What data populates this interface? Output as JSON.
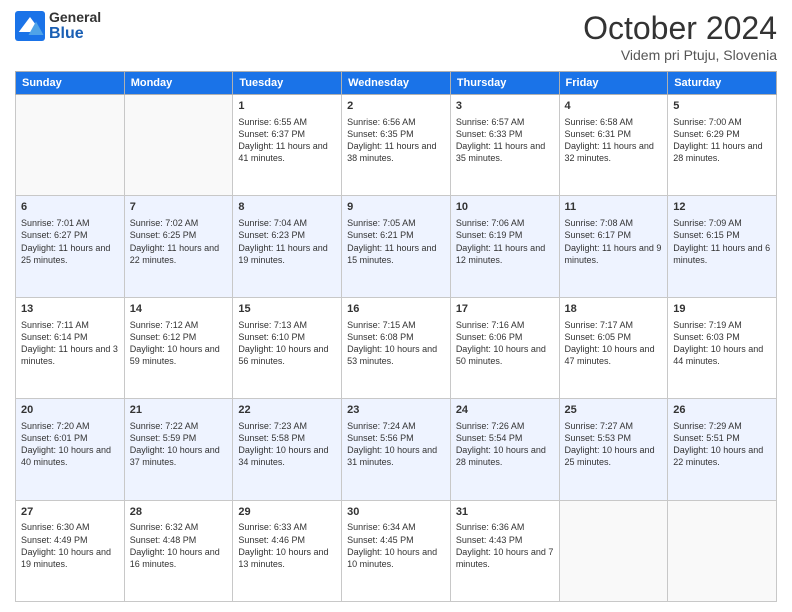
{
  "header": {
    "logo_general": "General",
    "logo_blue": "Blue",
    "month_title": "October 2024",
    "location": "Videm pri Ptuju, Slovenia"
  },
  "calendar": {
    "weekdays": [
      "Sunday",
      "Monday",
      "Tuesday",
      "Wednesday",
      "Thursday",
      "Friday",
      "Saturday"
    ],
    "weeks": [
      [
        {
          "day": "",
          "sunrise": "",
          "sunset": "",
          "daylight": ""
        },
        {
          "day": "",
          "sunrise": "",
          "sunset": "",
          "daylight": ""
        },
        {
          "day": "1",
          "sunrise": "Sunrise: 6:55 AM",
          "sunset": "Sunset: 6:37 PM",
          "daylight": "Daylight: 11 hours and 41 minutes."
        },
        {
          "day": "2",
          "sunrise": "Sunrise: 6:56 AM",
          "sunset": "Sunset: 6:35 PM",
          "daylight": "Daylight: 11 hours and 38 minutes."
        },
        {
          "day": "3",
          "sunrise": "Sunrise: 6:57 AM",
          "sunset": "Sunset: 6:33 PM",
          "daylight": "Daylight: 11 hours and 35 minutes."
        },
        {
          "day": "4",
          "sunrise": "Sunrise: 6:58 AM",
          "sunset": "Sunset: 6:31 PM",
          "daylight": "Daylight: 11 hours and 32 minutes."
        },
        {
          "day": "5",
          "sunrise": "Sunrise: 7:00 AM",
          "sunset": "Sunset: 6:29 PM",
          "daylight": "Daylight: 11 hours and 28 minutes."
        }
      ],
      [
        {
          "day": "6",
          "sunrise": "Sunrise: 7:01 AM",
          "sunset": "Sunset: 6:27 PM",
          "daylight": "Daylight: 11 hours and 25 minutes."
        },
        {
          "day": "7",
          "sunrise": "Sunrise: 7:02 AM",
          "sunset": "Sunset: 6:25 PM",
          "daylight": "Daylight: 11 hours and 22 minutes."
        },
        {
          "day": "8",
          "sunrise": "Sunrise: 7:04 AM",
          "sunset": "Sunset: 6:23 PM",
          "daylight": "Daylight: 11 hours and 19 minutes."
        },
        {
          "day": "9",
          "sunrise": "Sunrise: 7:05 AM",
          "sunset": "Sunset: 6:21 PM",
          "daylight": "Daylight: 11 hours and 15 minutes."
        },
        {
          "day": "10",
          "sunrise": "Sunrise: 7:06 AM",
          "sunset": "Sunset: 6:19 PM",
          "daylight": "Daylight: 11 hours and 12 minutes."
        },
        {
          "day": "11",
          "sunrise": "Sunrise: 7:08 AM",
          "sunset": "Sunset: 6:17 PM",
          "daylight": "Daylight: 11 hours and 9 minutes."
        },
        {
          "day": "12",
          "sunrise": "Sunrise: 7:09 AM",
          "sunset": "Sunset: 6:15 PM",
          "daylight": "Daylight: 11 hours and 6 minutes."
        }
      ],
      [
        {
          "day": "13",
          "sunrise": "Sunrise: 7:11 AM",
          "sunset": "Sunset: 6:14 PM",
          "daylight": "Daylight: 11 hours and 3 minutes."
        },
        {
          "day": "14",
          "sunrise": "Sunrise: 7:12 AM",
          "sunset": "Sunset: 6:12 PM",
          "daylight": "Daylight: 10 hours and 59 minutes."
        },
        {
          "day": "15",
          "sunrise": "Sunrise: 7:13 AM",
          "sunset": "Sunset: 6:10 PM",
          "daylight": "Daylight: 10 hours and 56 minutes."
        },
        {
          "day": "16",
          "sunrise": "Sunrise: 7:15 AM",
          "sunset": "Sunset: 6:08 PM",
          "daylight": "Daylight: 10 hours and 53 minutes."
        },
        {
          "day": "17",
          "sunrise": "Sunrise: 7:16 AM",
          "sunset": "Sunset: 6:06 PM",
          "daylight": "Daylight: 10 hours and 50 minutes."
        },
        {
          "day": "18",
          "sunrise": "Sunrise: 7:17 AM",
          "sunset": "Sunset: 6:05 PM",
          "daylight": "Daylight: 10 hours and 47 minutes."
        },
        {
          "day": "19",
          "sunrise": "Sunrise: 7:19 AM",
          "sunset": "Sunset: 6:03 PM",
          "daylight": "Daylight: 10 hours and 44 minutes."
        }
      ],
      [
        {
          "day": "20",
          "sunrise": "Sunrise: 7:20 AM",
          "sunset": "Sunset: 6:01 PM",
          "daylight": "Daylight: 10 hours and 40 minutes."
        },
        {
          "day": "21",
          "sunrise": "Sunrise: 7:22 AM",
          "sunset": "Sunset: 5:59 PM",
          "daylight": "Daylight: 10 hours and 37 minutes."
        },
        {
          "day": "22",
          "sunrise": "Sunrise: 7:23 AM",
          "sunset": "Sunset: 5:58 PM",
          "daylight": "Daylight: 10 hours and 34 minutes."
        },
        {
          "day": "23",
          "sunrise": "Sunrise: 7:24 AM",
          "sunset": "Sunset: 5:56 PM",
          "daylight": "Daylight: 10 hours and 31 minutes."
        },
        {
          "day": "24",
          "sunrise": "Sunrise: 7:26 AM",
          "sunset": "Sunset: 5:54 PM",
          "daylight": "Daylight: 10 hours and 28 minutes."
        },
        {
          "day": "25",
          "sunrise": "Sunrise: 7:27 AM",
          "sunset": "Sunset: 5:53 PM",
          "daylight": "Daylight: 10 hours and 25 minutes."
        },
        {
          "day": "26",
          "sunrise": "Sunrise: 7:29 AM",
          "sunset": "Sunset: 5:51 PM",
          "daylight": "Daylight: 10 hours and 22 minutes."
        }
      ],
      [
        {
          "day": "27",
          "sunrise": "Sunrise: 6:30 AM",
          "sunset": "Sunset: 4:49 PM",
          "daylight": "Daylight: 10 hours and 19 minutes."
        },
        {
          "day": "28",
          "sunrise": "Sunrise: 6:32 AM",
          "sunset": "Sunset: 4:48 PM",
          "daylight": "Daylight: 10 hours and 16 minutes."
        },
        {
          "day": "29",
          "sunrise": "Sunrise: 6:33 AM",
          "sunset": "Sunset: 4:46 PM",
          "daylight": "Daylight: 10 hours and 13 minutes."
        },
        {
          "day": "30",
          "sunrise": "Sunrise: 6:34 AM",
          "sunset": "Sunset: 4:45 PM",
          "daylight": "Daylight: 10 hours and 10 minutes."
        },
        {
          "day": "31",
          "sunrise": "Sunrise: 6:36 AM",
          "sunset": "Sunset: 4:43 PM",
          "daylight": "Daylight: 10 hours and 7 minutes."
        },
        {
          "day": "",
          "sunrise": "",
          "sunset": "",
          "daylight": ""
        },
        {
          "day": "",
          "sunrise": "",
          "sunset": "",
          "daylight": ""
        }
      ]
    ]
  }
}
